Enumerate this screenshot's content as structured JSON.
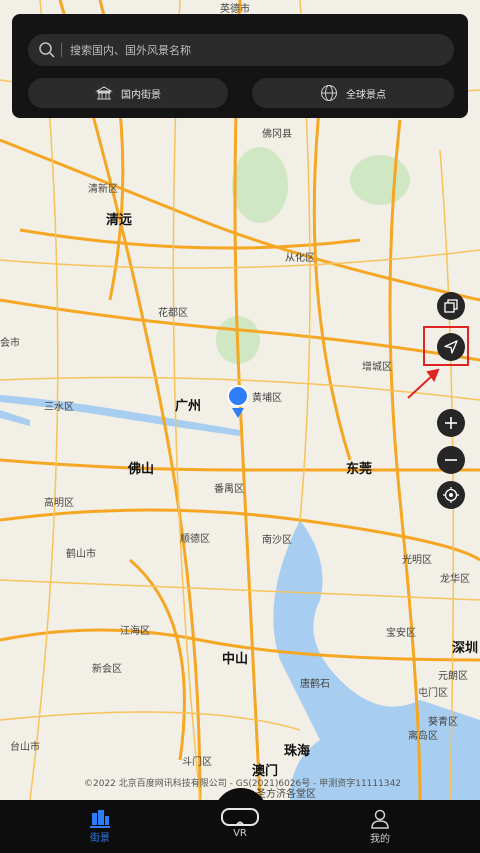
{
  "search": {
    "placeholder": "搜索国内、国外风景名称"
  },
  "top_buttons": {
    "domestic_label": "国内街景",
    "global_label": "全球景点"
  },
  "map": {
    "cities": [
      {
        "name": "英德市",
        "big": false
      },
      {
        "name": "佛冈县",
        "big": false
      },
      {
        "name": "清新区",
        "big": false
      },
      {
        "name": "清远",
        "big": true
      },
      {
        "name": "从化区",
        "big": false
      },
      {
        "name": "花都区",
        "big": false
      },
      {
        "name": "增城区",
        "big": false
      },
      {
        "name": "三水区",
        "big": false
      },
      {
        "name": "广州",
        "big": true
      },
      {
        "name": "黄埔区",
        "big": false
      },
      {
        "name": "佛山",
        "big": true
      },
      {
        "name": "东莞",
        "big": true
      },
      {
        "name": "高明区",
        "big": false
      },
      {
        "name": "番禺区",
        "big": false
      },
      {
        "name": "鹤山市",
        "big": false
      },
      {
        "name": "顺德区",
        "big": false
      },
      {
        "name": "南沙区",
        "big": false
      },
      {
        "name": "光明区",
        "big": false
      },
      {
        "name": "龙华区",
        "big": false
      },
      {
        "name": "江海区",
        "big": false
      },
      {
        "name": "宝安区",
        "big": false
      },
      {
        "name": "深圳",
        "big": true
      },
      {
        "name": "新会区",
        "big": false
      },
      {
        "name": "中山",
        "big": true
      },
      {
        "name": "元朗区",
        "big": false
      },
      {
        "name": "唐鹤石",
        "big": false
      },
      {
        "name": "屯门区",
        "big": false
      },
      {
        "name": "台山市",
        "big": false
      },
      {
        "name": "斗门区",
        "big": false
      },
      {
        "name": "珠海",
        "big": true
      },
      {
        "name": "葵青区",
        "big": false
      },
      {
        "name": "离岛区",
        "big": false
      },
      {
        "name": "澳门",
        "big": true
      },
      {
        "name": "圣方济各堂区",
        "big": false
      },
      {
        "name": "会市",
        "big": false
      }
    ],
    "copyright": "©2022 北京百度网讯科技有限公司 - GS(2021)6026号 - 甲测资字11111342"
  },
  "controls": [
    "layers-icon",
    "locate-arrow-icon",
    "zoom-in-icon",
    "zoom-out-icon",
    "my-location-icon"
  ],
  "tabbar": {
    "street_label": "街景",
    "vr_label": "VR",
    "mine_label": "我的"
  },
  "colors": {
    "accent": "#2f7df6",
    "highlight": "#e02424",
    "road": "#f5a623",
    "sea": "#a7cdf0"
  }
}
